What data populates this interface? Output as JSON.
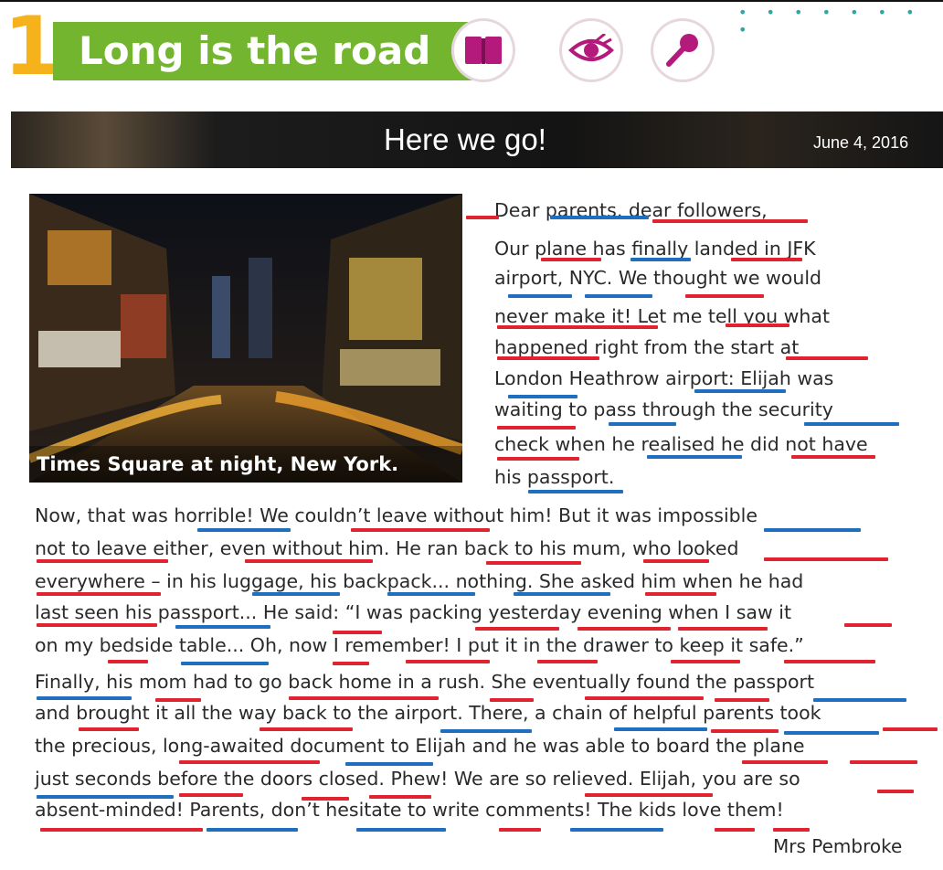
{
  "lesson": {
    "number": "1",
    "title": "Long is the road",
    "dots": "• • • • • • • •"
  },
  "icons": [
    "book-icon",
    "eye-icon",
    "microphone-icon"
  ],
  "colors": {
    "title_green": "#73b52f",
    "number_yellow": "#f6b21b",
    "icon_magenta": "#b4197c",
    "underline_red": "#e0232f",
    "underline_blue": "#1e6fc0"
  },
  "blog": {
    "heading": "Here we go!",
    "date": "June 4, 2016",
    "photo_caption": "Times Square at night, New York.",
    "right_lines": [
      "Dear parents, dear followers,",
      "Our plane has finally landed in JFK",
      "airport, NYC. We thought we would",
      "never make it! Let me tell you what",
      "happened right from the start at",
      "London Heathrow airport: Elijah was",
      "waiting to pass through the security",
      "check when he realised he did not have",
      "his passport."
    ],
    "body_lines": [
      "Now, that was horrible! We couldn’t leave without him! But it was impossible",
      "not to leave either, even without him. He ran back to his mum, who looked",
      "everywhere – in his luggage, his backpack... nothing. She asked him when he had",
      "last seen his passport... He said: “I was packing yesterday evening when I saw it",
      "on my bedside table... Oh, now I remember! I put it in the drawer to keep it safe.”",
      "Finally, his mom had to go back home in a rush. She eventually found the passport",
      "and brought it all the way back to the airport. There, a chain of helpful parents took",
      "the precious, long-awaited document to Elijah and he was able to board the plane",
      "just seconds before the doors closed. Phew! We are so relieved. Elijah, you are so",
      "absent-minded! Parents, don’t hesitate to write comments! The kids love them!"
    ],
    "signature": "Mrs Pembroke"
  }
}
